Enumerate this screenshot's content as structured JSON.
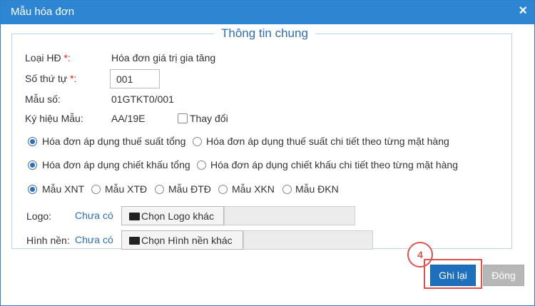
{
  "dialog": {
    "title": "Mẫu hóa đơn",
    "close_glyph": "×",
    "close_icon": "close-icon"
  },
  "group": {
    "legend": "Thông tin chung"
  },
  "fields": {
    "loai_hd_label": "Loại HĐ ",
    "loai_hd_req": "*:",
    "loai_hd_value": "Hóa đơn giá trị gia tăng",
    "so_thu_tu_label": "Số thứ tự ",
    "so_thu_tu_req": "*:",
    "so_thu_tu_value": "001",
    "mau_so_label": "Mẫu số:",
    "mau_so_value": "01GTKT0/001",
    "ky_hieu_label": "Ký hiệu Mẫu:",
    "ky_hieu_value": "AA/19E",
    "thay_doi_label": "Thay đổi",
    "thay_doi_checked": false
  },
  "radio_groups": {
    "tax": {
      "options": [
        "Hóa đơn áp dụng thuế suất tổng",
        "Hóa đơn áp dụng thuế suất chi tiết theo từng mặt hàng"
      ],
      "selected": 0
    },
    "discount": {
      "options": [
        "Hóa đơn áp dụng chiết khấu tổng",
        "Hóa đơn áp dụng chiết khấu chi tiết theo từng mặt hàng"
      ],
      "selected": 0
    },
    "template": {
      "options": [
        "Mẫu XNT",
        "Mẫu XTĐ",
        "Mẫu ĐTĐ",
        "Mẫu XKN",
        "Mẫu ĐKN"
      ],
      "selected": 0
    }
  },
  "logo": {
    "label": "Logo:",
    "status": "Chưa có",
    "button": "Chọn Logo khác",
    "button_icon": "folder-open-icon"
  },
  "background": {
    "label": "Hình nền:",
    "status": "Chưa có",
    "button": "Chọn Hình nền khác",
    "button_icon": "folder-open-icon"
  },
  "step_badge": "4",
  "buttons": {
    "save": "Ghi lại",
    "close": "Đóng"
  },
  "colors": {
    "titlebar": "#2e86d3",
    "accent": "#2f6db3",
    "highlight": "#d9534f"
  }
}
